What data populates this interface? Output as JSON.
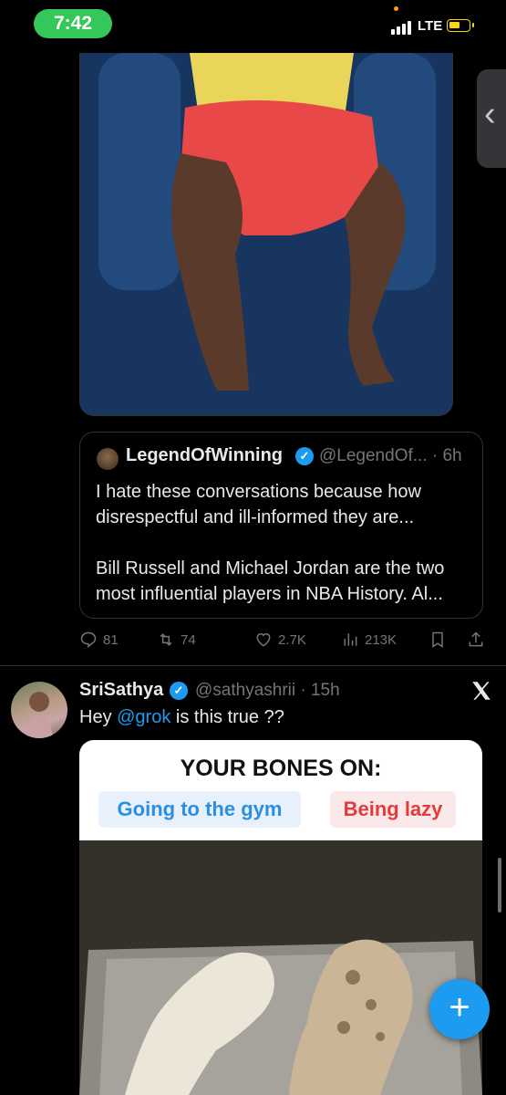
{
  "status_bar": {
    "time": "7:42",
    "network": "LTE"
  },
  "quoted_post": {
    "display_name": "LegendOfWinning",
    "handle_time": "@LegendOf... · 6h",
    "paragraph1": "I hate these conversations because how disrespectful and ill-informed they are...",
    "paragraph2": "Bill Russell and Michael Jordan are the two most influential players in NBA History. Al..."
  },
  "actions": {
    "replies": "81",
    "reposts": "74",
    "likes": "2.7K",
    "views": "213K"
  },
  "post": {
    "display_name": "SriSathya",
    "handle_time": "@sathyashrii · 15h",
    "text_before": "Hey ",
    "mention": "@grok",
    "text_after": " is this true ??",
    "media": {
      "title": "YOUR BONES ON:",
      "label_left": "Going to the gym",
      "label_right": "Being lazy"
    }
  },
  "colors": {
    "accent": "#1d9bf0",
    "status_green": "#34c759",
    "battery_yellow": "#ffd60a"
  }
}
